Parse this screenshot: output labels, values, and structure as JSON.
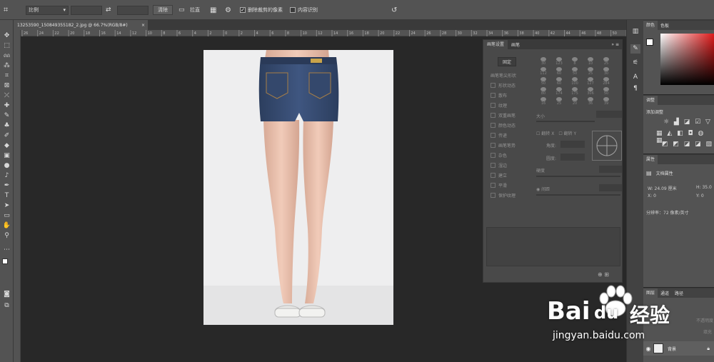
{
  "options_bar": {
    "ratio_select": "比例",
    "clear_label": "清除",
    "straighten_label": "拉直",
    "delete_cropped_label": "删除裁剪的像素",
    "content_aware_label": "内容识别"
  },
  "document": {
    "tab_title": "13253590_150849355182_2.jpg @ 66.7%(RGB/8#)",
    "close_glyph": "×"
  },
  "ruler_marks": [
    "26",
    "24",
    "22",
    "20",
    "18",
    "16",
    "14",
    "12",
    "10",
    "8",
    "6",
    "4",
    "2",
    "0",
    "2",
    "4",
    "6",
    "8",
    "10",
    "12",
    "14",
    "16",
    "18",
    "20",
    "22",
    "24",
    "26",
    "28",
    "30",
    "32",
    "34",
    "36",
    "38",
    "40",
    "42",
    "44",
    "46",
    "48",
    "50",
    "52"
  ],
  "brush_panel": {
    "tabs": [
      "画笔设置",
      "画笔"
    ],
    "lock_button": "固定",
    "tip_shape": "画笔笔尖形状",
    "options": [
      "形状动态",
      "散布",
      "纹理",
      "双重画笔",
      "颜色动态",
      "传递",
      "画笔笔势",
      "杂色",
      "湿边",
      "建立",
      "平滑",
      "保护纹理"
    ],
    "size_label": "大小",
    "flip_x": "翻转 X",
    "flip_y": "翻转 Y",
    "angle_label": "角度:",
    "roundness_label": "圆度:",
    "hardness_label": "硬度",
    "spacing_label": "间距",
    "brush_numbers": [
      "30",
      "123",
      "8",
      "10",
      "25",
      "112",
      "60",
      "50",
      "25",
      "30",
      "50",
      "60",
      "100",
      "127",
      "284",
      "80",
      "174",
      "175",
      "306",
      "50",
      "16",
      "25",
      "20",
      "36",
      "39"
    ]
  },
  "color_panel": {
    "tabs": [
      "颜色",
      "色板"
    ]
  },
  "adjust_panel": {
    "tab": "调整",
    "label": "添加调整"
  },
  "props_panel": {
    "tab": "属性",
    "doc_props": "文档属性",
    "w_label": "W:",
    "w_value": "24.09 厘米",
    "h_label": "H:",
    "h_value": "35.0",
    "x_label": "X:",
    "x_value": "0",
    "y_label": "Y:",
    "y_value": "0",
    "resolution": "分辨率：72 像素/英寸"
  },
  "layers_panel": {
    "tabs": [
      "图层",
      "通道",
      "路径"
    ],
    "opacity_label": "不透明度",
    "fill_label": "填充",
    "layer_name": "背景"
  },
  "watermark": {
    "brand": "Bai",
    "du": "du",
    "cn": "经验",
    "url": "jingyan.baidu.com"
  }
}
